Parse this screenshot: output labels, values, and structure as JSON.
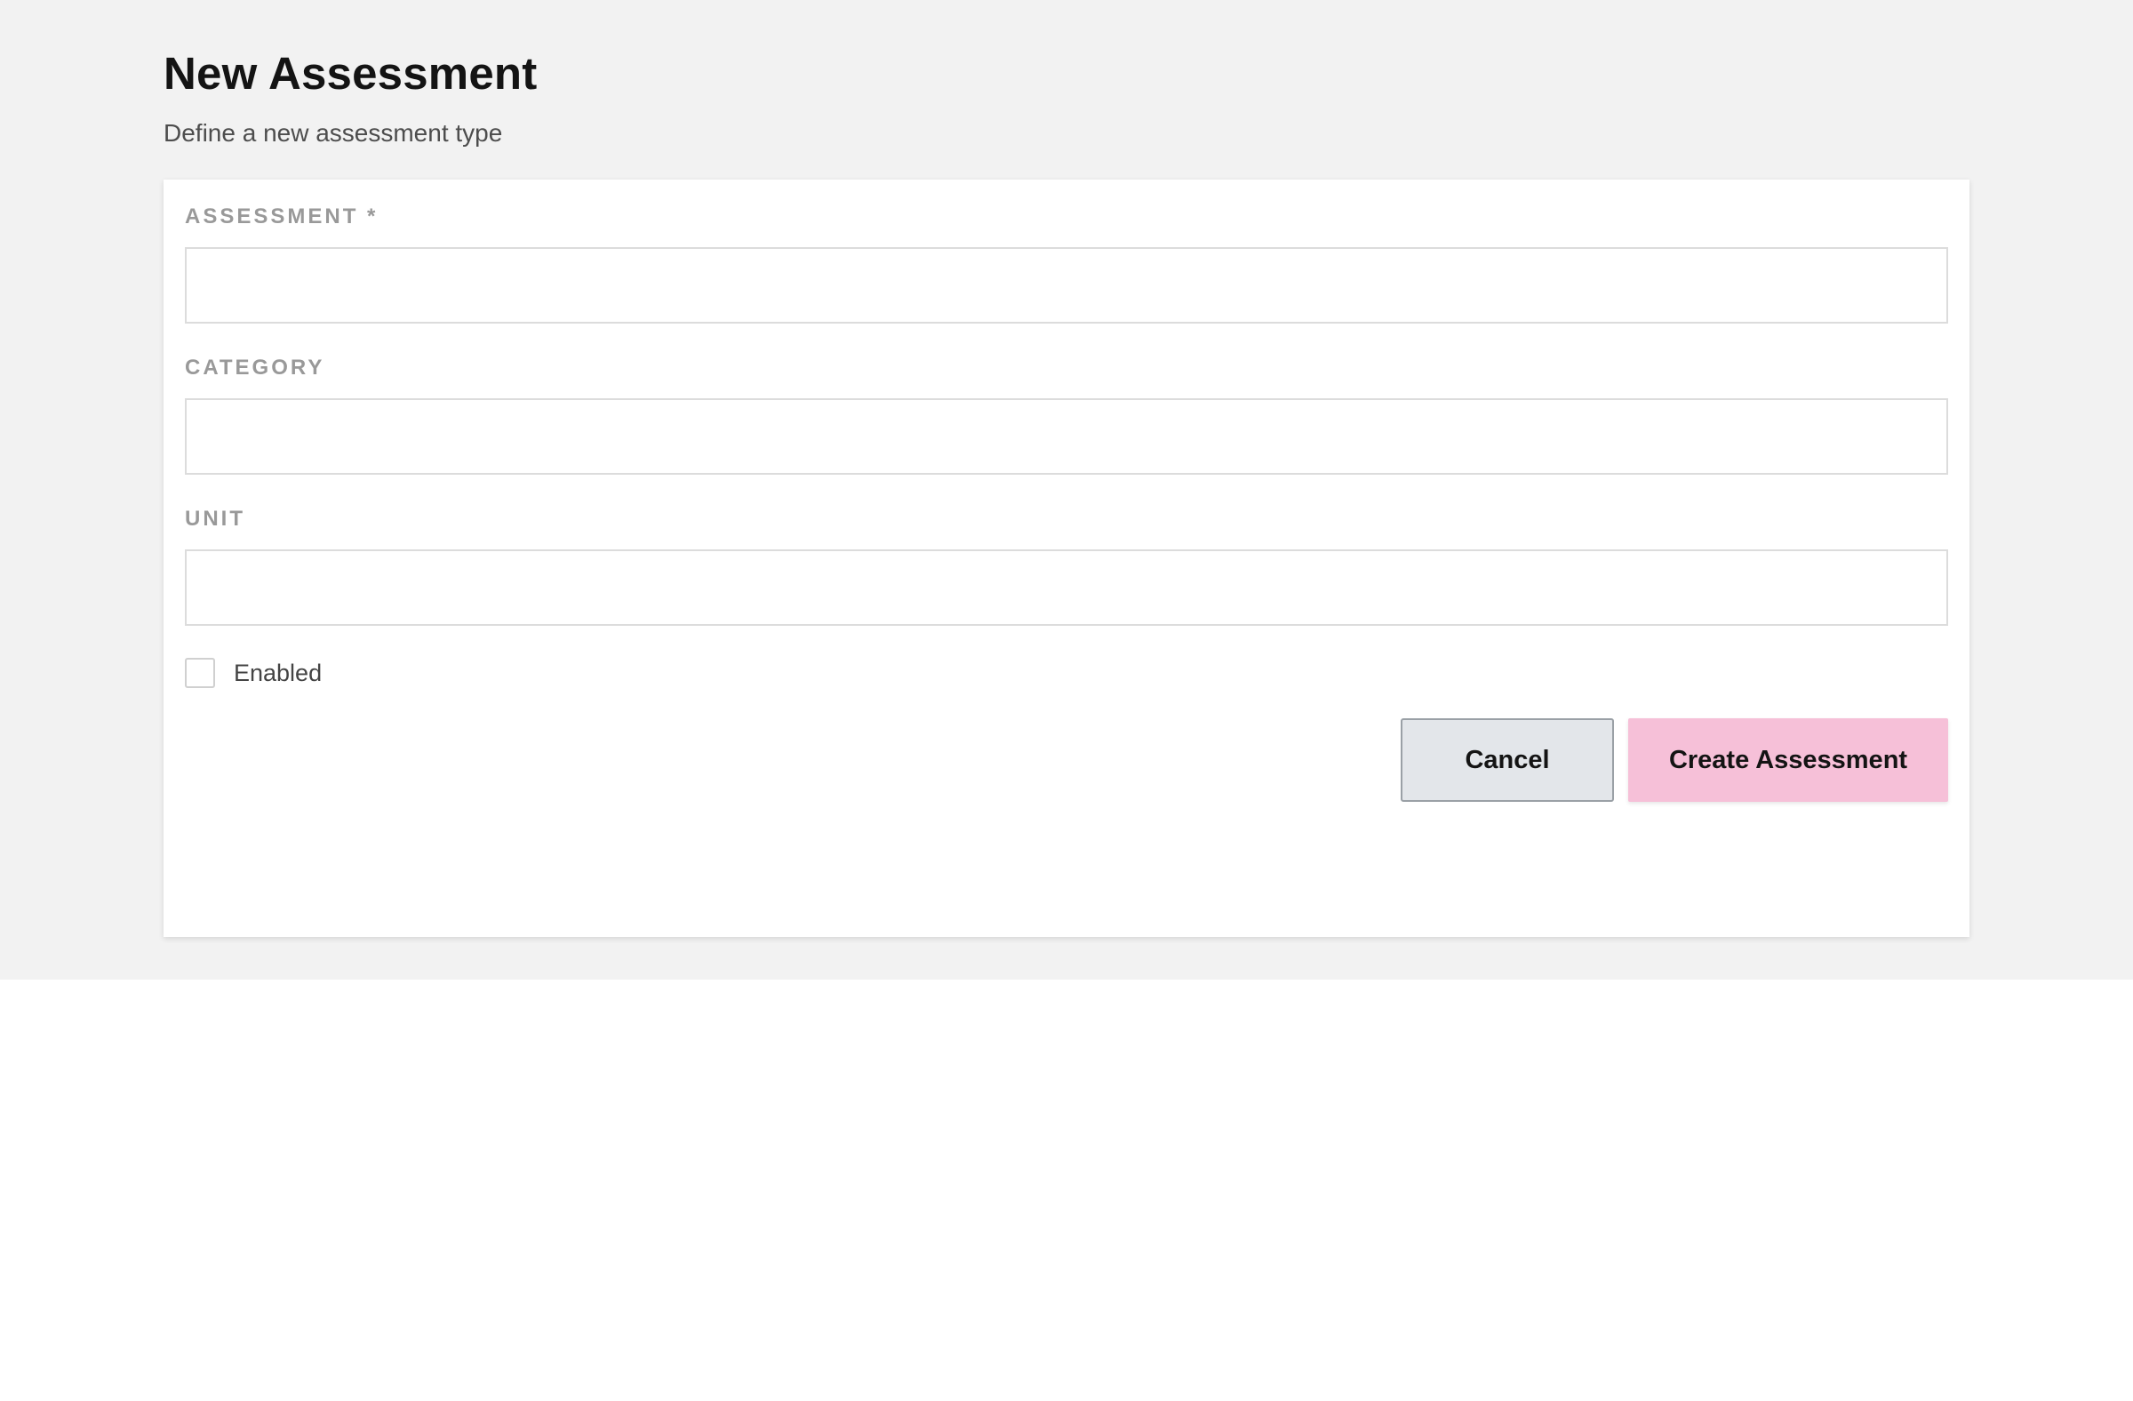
{
  "page": {
    "title": "New Assessment",
    "subtitle": "Define a new assessment type"
  },
  "form": {
    "fields": [
      {
        "label": "ASSESSMENT *",
        "value": "",
        "placeholder": ""
      },
      {
        "label": "CATEGORY",
        "value": "",
        "placeholder": ""
      },
      {
        "label": "UNIT",
        "value": "",
        "placeholder": ""
      }
    ],
    "enabled": {
      "label": "Enabled",
      "checked": false
    },
    "cancel_label": "Cancel",
    "submit_label": "Create Assessment"
  },
  "colors": {
    "backdrop": "#f2f2f2",
    "primary_button": "#f6c0d8",
    "secondary_button": "#e3e6ea"
  }
}
